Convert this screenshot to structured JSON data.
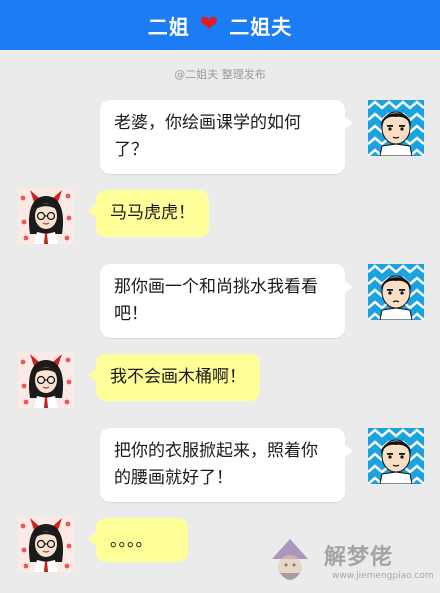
{
  "header": {
    "name_left": "二姐",
    "heart_icon": "heart-icon",
    "name_right": "二姐夫"
  },
  "credit": "@二姐夫 整理发布",
  "messages": [
    {
      "side": "right",
      "text": "老婆，你绘画课学的如何了？"
    },
    {
      "side": "left",
      "text": "马马虎虎！"
    },
    {
      "side": "right",
      "text": "那你画一个和尚挑水我看看吧！"
    },
    {
      "side": "left",
      "text": "我不会画木桶啊！"
    },
    {
      "side": "right",
      "text": "把你的衣服掀起来，照着你的腰画就好了！"
    },
    {
      "side": "left",
      "text": "。。。。"
    }
  ],
  "watermark": {
    "text": "解梦佬",
    "url": "www.jiemengpiao.com"
  },
  "colors": {
    "header": "#1c7cf4",
    "heart": "#e5191f",
    "bubble_left": "#ffff99",
    "bubble_right": "#ffffff",
    "male_avatar_bg": "#1aa3e0"
  }
}
